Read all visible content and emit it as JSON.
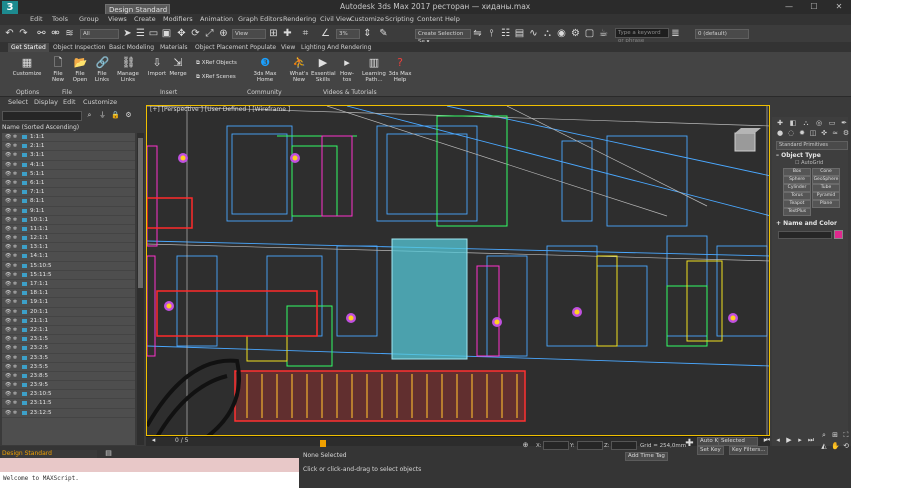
{
  "window": {
    "title": "Autodesk 3ds Max 2017    ресторан — хиданы.max",
    "workspace": "Design Standard",
    "logo": "3"
  },
  "menu": [
    "Edit",
    "Tools",
    "Group",
    "Views",
    "Create",
    "Modifiers",
    "Animation",
    "Graph Editors",
    "Rendering",
    "Civil View",
    "Customize",
    "Scripting",
    "Content",
    "Help"
  ],
  "search_placeholder": "Type a keyword or phrase",
  "toolbar": {
    "filter": "All",
    "view": "View",
    "selection_set": "Create Selection Se ▾",
    "layer": "0 (default)",
    "percent": "3%"
  },
  "ribbon_tabs": [
    "Get Started",
    "Object Inspection",
    "Basic Modeling",
    "Materials",
    "Object Placement",
    "Populate",
    "View",
    "Lighting And Rendering"
  ],
  "ribbon": {
    "customize": "Customize",
    "file_new": "File New",
    "file_open": "File Open",
    "file_links": "File Links",
    "manage_links": "Manage Links",
    "import": "Import",
    "merge": "Merge",
    "xref_objects": "XRef Objects",
    "xref_scenes": "XRef Scenes",
    "max_home": "3ds Max Home",
    "whats_new": "What's New",
    "essential_skills": "Essential Skills",
    "how_tos": "How-tos",
    "learning_path": "Learning Path...",
    "max_help": "3ds Max Help",
    "groups": {
      "options": "Options",
      "file": "File",
      "insert": "Insert",
      "community": "Community",
      "videos": "Videos & Tutorials"
    }
  },
  "scene_explorer": {
    "tabs": [
      "Select",
      "Display",
      "Edit",
      "Customize"
    ],
    "header": "Name (Sorted Ascending)",
    "rows": [
      "1:1:1",
      "2:1:1",
      "3:1:1",
      "4:1:1",
      "5:1:1",
      "6:1:1",
      "7:1:1",
      "8:1:1",
      "9:1:1",
      "10:1:1",
      "11:1:1",
      "12:1:1",
      "13:1:1",
      "14:1:1",
      "15:10:5",
      "15:11:5",
      "17:1:1",
      "18:1:1",
      "19:1:1",
      "20:1:1",
      "21:1:1",
      "22:1:1",
      "23:1:5",
      "23:2:5",
      "23:3:5",
      "23:5:5",
      "23:8:5",
      "23:9:5",
      "23:10:5",
      "23:11:5",
      "23:12:5"
    ]
  },
  "viewport": {
    "label": "[+] [Perspective ] [User Defined ] [Wireframe ]"
  },
  "command_panel": {
    "dropdown": "Standard Primitives",
    "object_type": "Object Type",
    "autogrid": "AutoGrid",
    "buttons": [
      "Box",
      "Cone",
      "Sphere",
      "GeoSphere",
      "Cylinder",
      "Tube",
      "Torus",
      "Pyramid",
      "Teapot",
      "Plane",
      "TextPlus"
    ],
    "name_color": "Name and Color"
  },
  "timeline": {
    "frame": "0 / 5"
  },
  "status": {
    "workspace": "Design Standard",
    "maxscript": "Welcome to MAXScript.",
    "selection": "None Selected",
    "hint": "Click or click-and-drag to select objects",
    "x": "X:",
    "y": "Y:",
    "z": "Z:",
    "grid": "Grid = 254,0mm",
    "add_time_tag": "Add Time Tag",
    "auto_key": "Auto Key",
    "selected": "Selected",
    "set_key": "Set Key",
    "key_filters": "Key Filters..."
  }
}
